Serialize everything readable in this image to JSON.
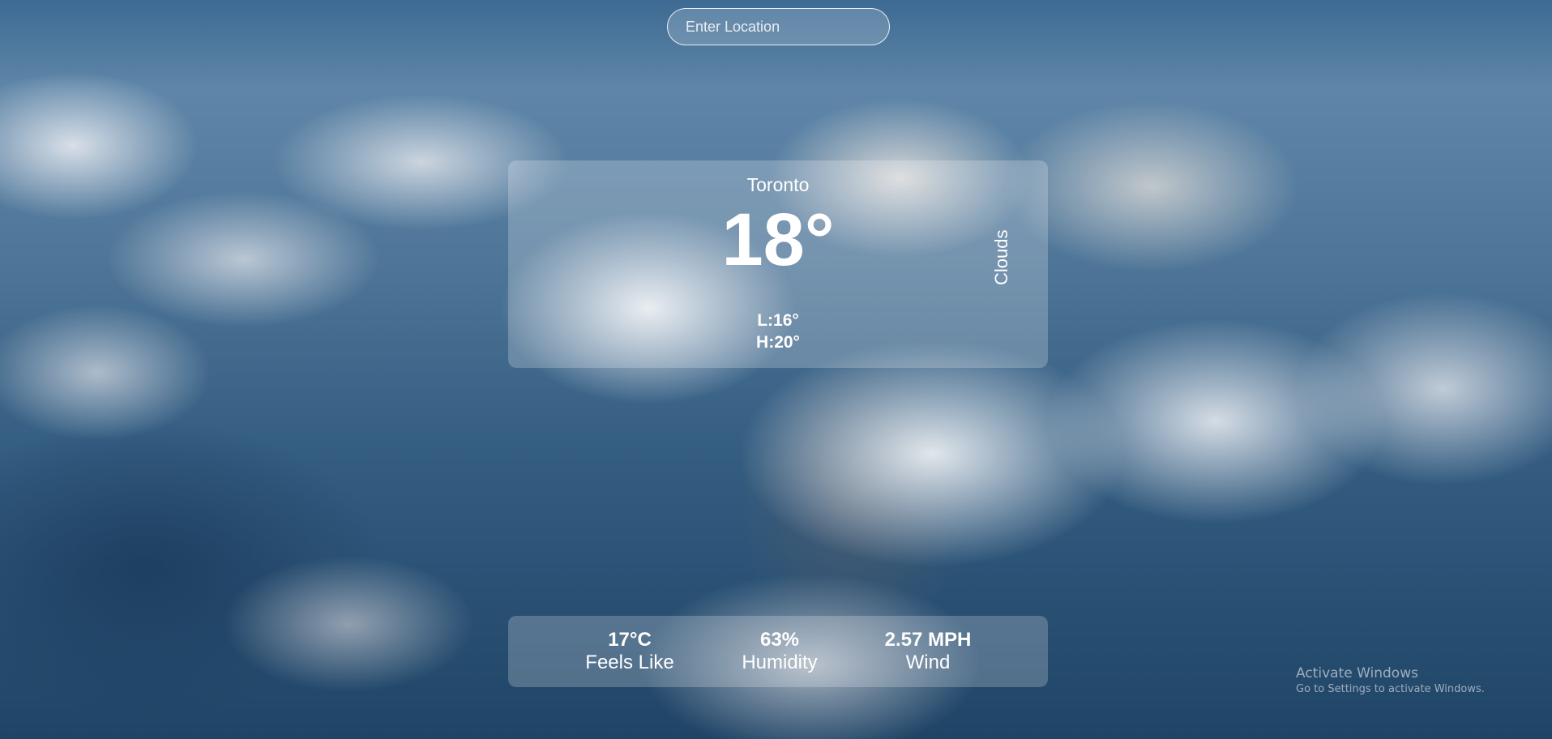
{
  "search": {
    "placeholder": "Enter Location",
    "value": ""
  },
  "weather": {
    "city": "Toronto",
    "temperature": "18°",
    "condition": "Clouds",
    "low": "L:16°",
    "high": "H:20°"
  },
  "stats": {
    "feels_like": {
      "value": "17°C",
      "label": "Feels Like"
    },
    "humidity": {
      "value": "63%",
      "label": "Humidity"
    },
    "wind": {
      "value": "2.57 MPH",
      "label": "Wind"
    }
  },
  "watermark": {
    "title": "Activate Windows",
    "subtitle": "Go to Settings to activate Windows."
  },
  "colors": {
    "text": "#ffffff",
    "sky": "#3d6a93"
  }
}
